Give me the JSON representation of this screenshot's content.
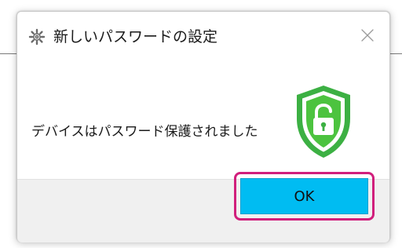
{
  "dialog": {
    "title": "新しいパスワードの設定",
    "message": "デバイスはパスワード保護されました",
    "ok_label": "OK",
    "icons": {
      "app": "gear-icon",
      "close": "close-icon",
      "status": "shield-unlocked-icon"
    }
  },
  "colors": {
    "ok_button": "#00bcf2",
    "highlight": "#d11f7c",
    "shield_green": "#3cb043"
  }
}
